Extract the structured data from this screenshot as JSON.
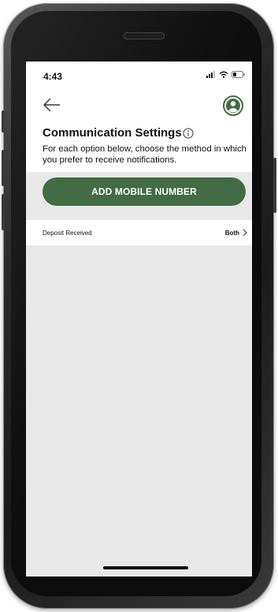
{
  "status_bar": {
    "time": "4:43",
    "signal_icon": "signal-icon",
    "wifi_icon": "wifi-icon",
    "battery_icon": "battery-icon"
  },
  "header": {
    "back_icon": "arrow-left-icon",
    "profile_icon": "user-circle-icon"
  },
  "page": {
    "title": "Communication Settings",
    "info_icon": "info-icon",
    "description": "For each option below, choose the method in which you prefer to receive notifications."
  },
  "actions": {
    "add_mobile_label": "ADD MOBILE NUMBER"
  },
  "options": [
    {
      "label": "Deposit Received",
      "value": "Both",
      "chevron_icon": "chevron-right-icon"
    }
  ],
  "colors": {
    "accent_green": "#426c44",
    "screen_background": "#e8e8e8",
    "surface": "#ffffff"
  }
}
